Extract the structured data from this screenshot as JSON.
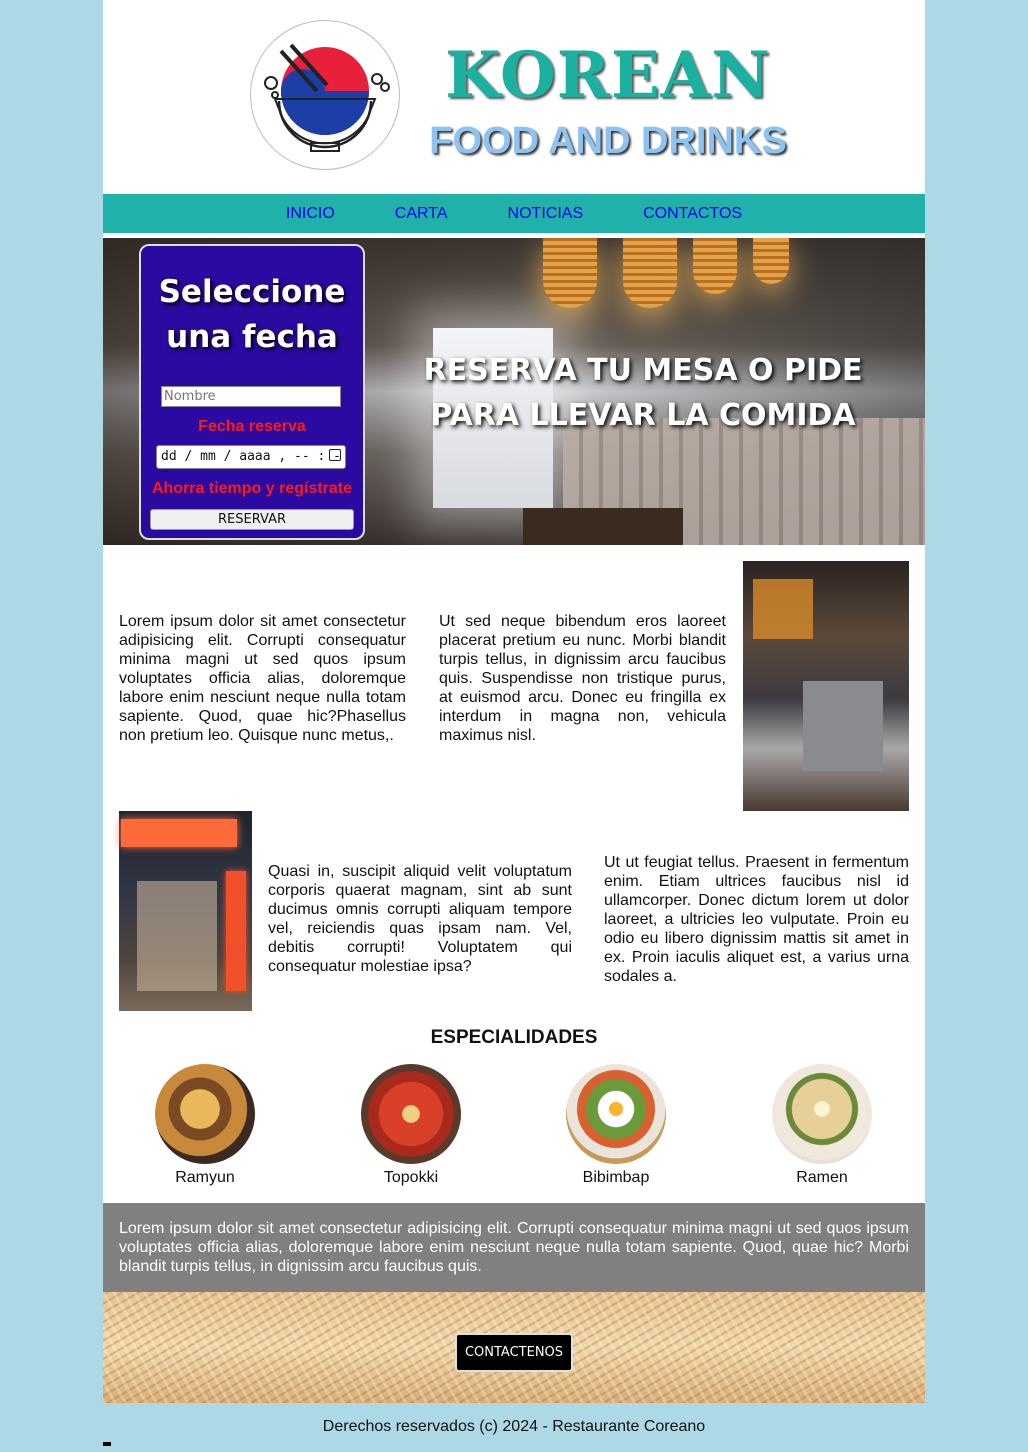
{
  "header": {
    "title": "KOREAN",
    "subtitle": "FOOD AND DRINKS",
    "logo_icon": "korean-bowl-logo-icon",
    "title_color": "#1bb0a0",
    "subtitle_color": "#8ec3f0"
  },
  "nav": {
    "items": [
      "INICIO",
      "CARTA",
      "NOTICIAS",
      "CONTACTOS"
    ],
    "background": "#20b2aa"
  },
  "hero": {
    "heading": "RESERVA TU MESA O PIDE PARA LLEVAR LA COMIDA",
    "form": {
      "title": "Seleccione una fecha",
      "name_placeholder": "Nombre",
      "date_label": "Fecha reserva",
      "date_placeholder": "dd / mm / aaaa ,  -- : --",
      "register_text": "Ahorra tiempo y regístrate",
      "submit_label": "RESERVAR",
      "background": "#2a0aa0"
    }
  },
  "content": {
    "row1_col1": "Lorem ipsum dolor sit amet consectetur adipisicing elit. Corrupti consequatur minima magni ut sed quos ipsum voluptates officia alias, doloremque labore enim nesciunt neque nulla totam sapiente. Quod, quae hic?Phasellus non pretium leo. Quisque nunc metus,.",
    "row1_col2": "Ut sed neque bibendum eros laoreet placerat pretium eu nunc. Morbi blandit turpis tellus, in dignissim arcu faucibus quis. Suspendisse non tristique purus, at euismod arcu. Donec eu fringilla ex interdum in magna non, vehicula maximus nisl.",
    "row2_col2": "Quasi in, suscipit aliquid velit voluptatum corporis quaerat magnam, sint ab sunt ducimus omnis corrupti aliquam tempore vel, reiciendis quas ipsam nam. Vel, debitis corrupti! Voluptatem qui consequatur molestiae ipsa?",
    "row2_col3": "Ut ut feugiat tellus. Praesent in fermentum enim. Etiam ultrices faucibus nisl id ullamcorper. Donec dictum lorem ut dolor laoreet, a ultricies leo vulputate. Proin eu odio eu libero dignissim mattis sit amet in ex. Proin iaculis aliquet est, a varius urna sodales a."
  },
  "specialties": {
    "title": "ESPECIALIDADES",
    "items": [
      {
        "name": "Ramyun",
        "color": "#c9893a"
      },
      {
        "name": "Topokki",
        "color": "#c23b22"
      },
      {
        "name": "Bibimbap",
        "color": "#d8a85a"
      },
      {
        "name": "Ramen",
        "color": "#e7cf9a"
      }
    ]
  },
  "banner_text": "Lorem ipsum dolor sit amet consectetur adipisicing elit. Corrupti consequatur minima magni ut sed quos ipsum voluptates officia alias, doloremque labore enim nesciunt neque nulla totam sapiente. Quod, quae hic? Morbi blandit turpis tellus, in dignissim arcu faucibus quis.",
  "cta": {
    "label": "CONTACTENOS"
  },
  "footer": {
    "text": "Derechos reservados (c) 2024 - Restaurante Coreano"
  },
  "colors": {
    "page_background": "#add8e6",
    "banner_gray": "#808080"
  }
}
